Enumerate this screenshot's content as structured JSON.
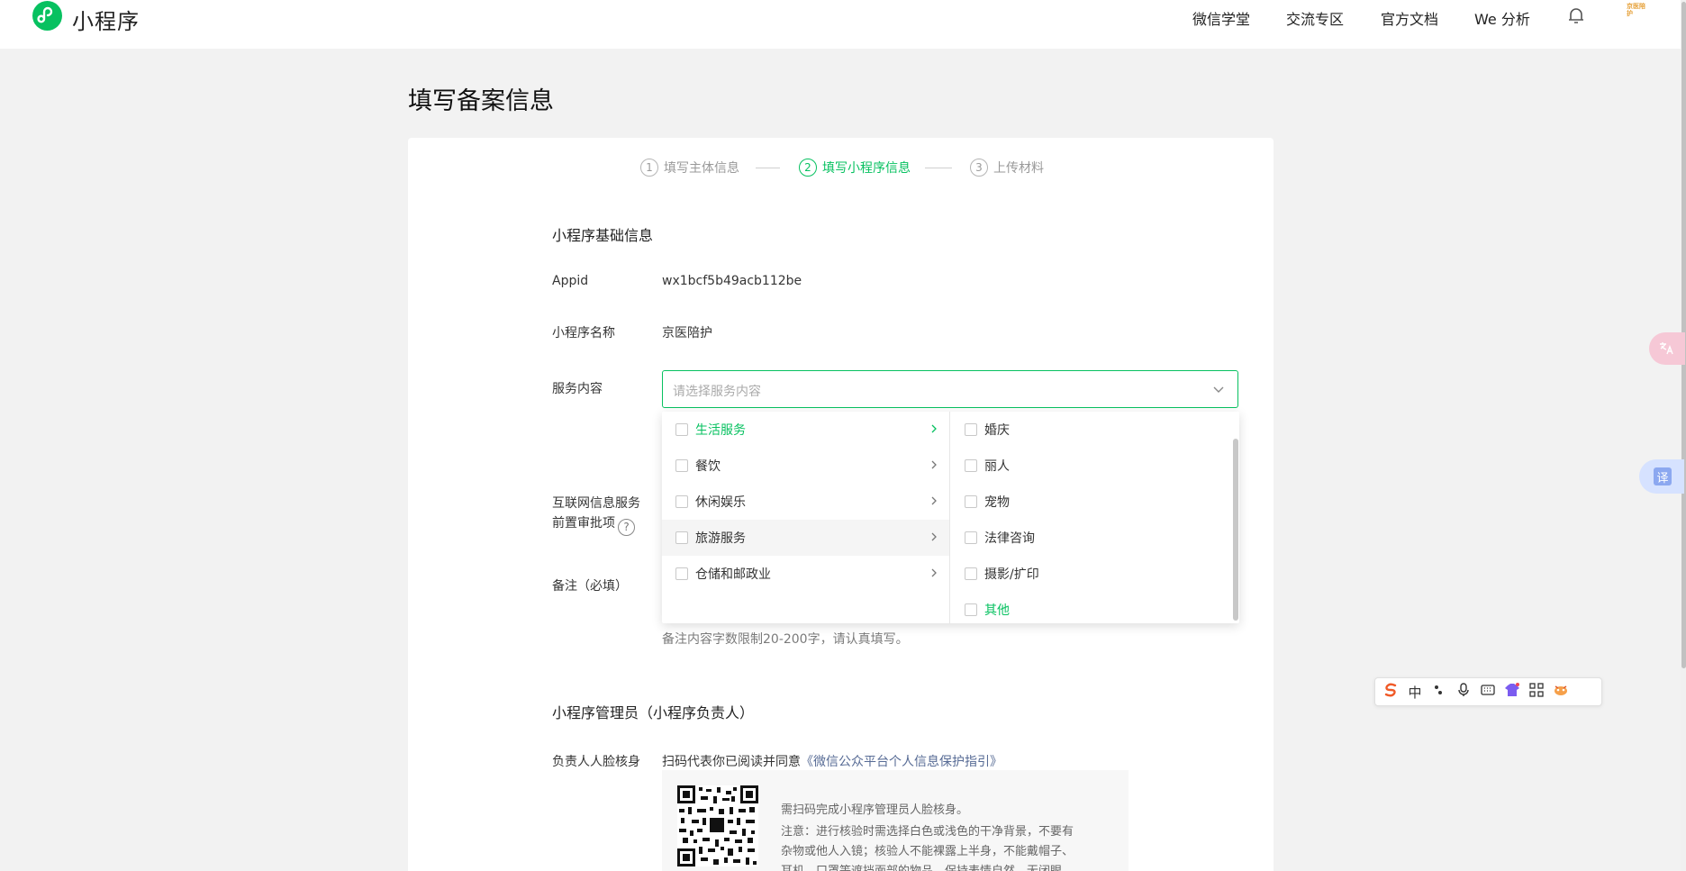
{
  "header": {
    "brand": "小程序",
    "nav": [
      "微信学堂",
      "交流专区",
      "官方文档",
      "We 分析"
    ],
    "avatar_text": "京医陪护"
  },
  "page": {
    "title": "填写备案信息"
  },
  "steps": [
    {
      "num": "1",
      "label": "填写主体信息"
    },
    {
      "num": "2",
      "label": "填写小程序信息"
    },
    {
      "num": "3",
      "label": "上传材料"
    }
  ],
  "basic": {
    "section_title": "小程序基础信息",
    "appid_label": "Appid",
    "appid_value": "wx1bcf5b49acb112be",
    "name_label": "小程序名称",
    "name_value": "京医陪护",
    "service_label": "服务内容",
    "service_placeholder": "请选择服务内容",
    "internet_label_1": "互联网信息服务",
    "internet_label_2": "前置审批项",
    "help_glyph": "?",
    "remark_label": "备注（必填）",
    "remark_hint": "备注内容字数限制20-200字，请认真填写。"
  },
  "dropdown": {
    "left": [
      "生活服务",
      "餐饮",
      "休闲娱乐",
      "旅游服务",
      "仓储和邮政业"
    ],
    "right": [
      "婚庆",
      "丽人",
      "宠物",
      "法律咨询",
      "摄影/扩印",
      "其他"
    ]
  },
  "admin": {
    "section_title": "小程序管理员（小程序负责人）",
    "face_label": "负责人人脸核身",
    "agree_prefix": "扫码代表你已阅读并同意",
    "agree_link": "《微信公众平台个人信息保护指引》",
    "scan_tip": "需扫码完成小程序管理员人脸核身。",
    "notice_1": "注意：进行核验时需选择白色或浅色的干净背景，不要有",
    "notice_2": "杂物或他人入镜；核验人不能裸露上半身，不能戴帽子、",
    "notice_3": "耳机、口罩等遮挡面部的物品，保持表情自然，无闭眼、"
  },
  "widgets": {
    "translate_glyph": "译",
    "ime_lang": "中"
  },
  "colors": {
    "accent": "#07c160",
    "link": "#576b95"
  }
}
